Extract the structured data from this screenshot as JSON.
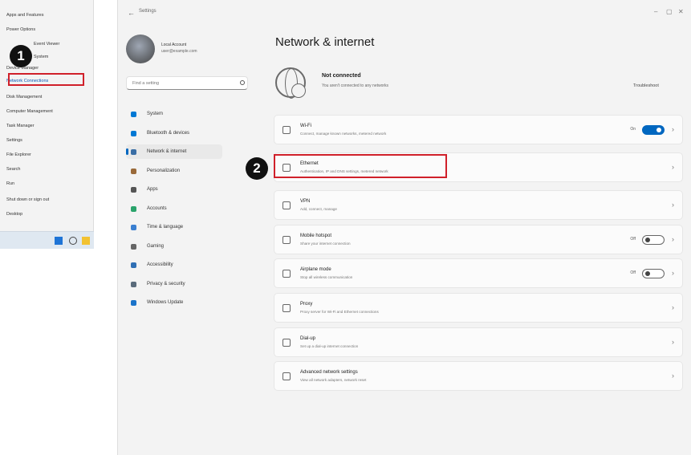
{
  "context_menu": {
    "items": [
      "Apps and Features",
      "Power Options",
      "Event Viewer",
      "System",
      "Device Manager",
      "Network Connections",
      "Disk Management",
      "Computer Management",
      "Task Manager",
      "Settings",
      "File Explorer",
      "Search",
      "Run",
      "Shut down or sign out",
      "Desktop"
    ],
    "highlighted_index": 5,
    "highlight_color": "#d0202a"
  },
  "taskbar": {
    "icons": [
      "windows-start-icon",
      "search-icon",
      "file-explorer-icon"
    ]
  },
  "window": {
    "back_glyph": "←",
    "title": "Settings",
    "controls": [
      "–",
      "▢",
      "✕"
    ]
  },
  "profile": {
    "name": "Local Account",
    "email": "user@example.com"
  },
  "search": {
    "placeholder": "Find a setting"
  },
  "nav": {
    "items": [
      {
        "label": "System",
        "icon": "monitor-icon",
        "color": "#0078d4"
      },
      {
        "label": "Bluetooth & devices",
        "icon": "bluetooth-icon",
        "color": "#0078d4"
      },
      {
        "label": "Network & internet",
        "icon": "network-icon",
        "color": "#3a6ea5",
        "active": true
      },
      {
        "label": "Personalization",
        "icon": "brush-icon",
        "color": "#9a6a3a"
      },
      {
        "label": "Apps",
        "icon": "apps-icon",
        "color": "#555555"
      },
      {
        "label": "Accounts",
        "icon": "person-icon",
        "color": "#2aa36b"
      },
      {
        "label": "Time & language",
        "icon": "clock-icon",
        "color": "#3a7fd0"
      },
      {
        "label": "Gaming",
        "icon": "gamepad-icon",
        "color": "#666666"
      },
      {
        "label": "Accessibility",
        "icon": "accessibility-icon",
        "color": "#2f6fb4"
      },
      {
        "label": "Privacy & security",
        "icon": "shield-icon",
        "color": "#5a6b7b"
      },
      {
        "label": "Windows Update",
        "icon": "update-icon",
        "color": "#1a73c9"
      }
    ]
  },
  "page": {
    "title": "Network & internet",
    "status_title": "Not connected",
    "status_desc": "You aren't connected to any networks",
    "status_link": "Troubleshoot"
  },
  "cards": [
    {
      "title": "Wi-Fi",
      "desc": "Connect, manage known networks, metered network",
      "icon": "wifi-icon",
      "toggle": "on",
      "toggle_label": "On"
    },
    {
      "title": "Ethernet",
      "desc": "Authentication, IP and DNS settings, metered network",
      "icon": "ethernet-icon",
      "highlight": true
    },
    {
      "title": "VPN",
      "desc": "Add, connect, manage",
      "icon": "vpn-icon"
    },
    {
      "title": "Mobile hotspot",
      "desc": "Share your internet connection",
      "icon": "hotspot-icon",
      "toggle": "off",
      "toggle_label": "Off"
    },
    {
      "title": "Airplane mode",
      "desc": "Stop all wireless communication",
      "icon": "airplane-icon",
      "toggle": "off",
      "toggle_label": "Off"
    },
    {
      "title": "Proxy",
      "desc": "Proxy server for Wi-Fi and Ethernet connections",
      "icon": "proxy-icon"
    },
    {
      "title": "Dial-up",
      "desc": "Set up a dial-up internet connection",
      "icon": "dialup-icon"
    },
    {
      "title": "Advanced network settings",
      "desc": "View all network adapters, network reset",
      "icon": "advanced-network-icon"
    }
  ],
  "steps": [
    "1",
    "2"
  ],
  "colors": {
    "accent": "#0067c0",
    "highlight": "#d0202a",
    "badge": "#111111"
  }
}
